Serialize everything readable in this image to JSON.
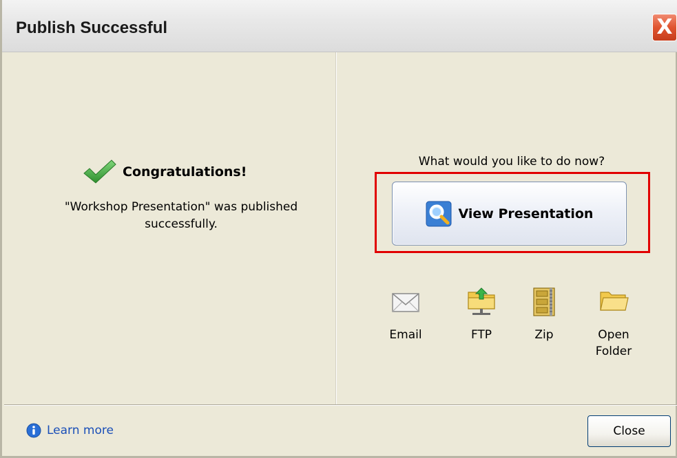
{
  "window": {
    "title": "Publish Successful",
    "close_glyph": "X"
  },
  "left": {
    "heading": "Congratulations!",
    "message": "\"Workshop Presentation\" was published successfully."
  },
  "right": {
    "prompt": "What would you like to do now?",
    "view_button": "View Presentation",
    "actions": [
      {
        "label": "Email",
        "icon": "envelope-icon"
      },
      {
        "label": "FTP",
        "icon": "ftp-folder-icon"
      },
      {
        "label": "Zip",
        "icon": "zip-archive-icon"
      },
      {
        "label": "Open Folder",
        "icon": "folder-icon"
      }
    ]
  },
  "footer": {
    "learn_more": "Learn more",
    "close_button": "Close"
  },
  "colors": {
    "highlight": "#e10000",
    "link": "#1a4fb8",
    "checkmark": "#3aa63a"
  }
}
